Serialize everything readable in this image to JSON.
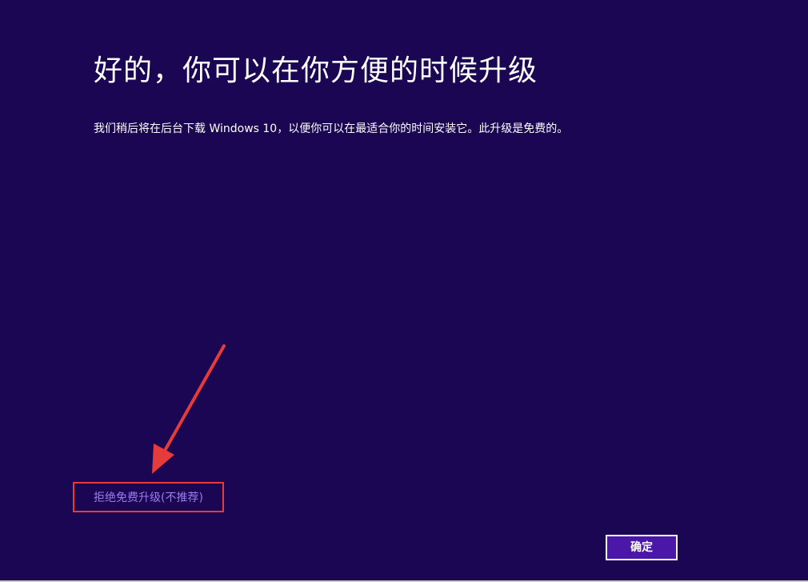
{
  "page": {
    "title": "好的，你可以在你方便的时候升级",
    "description": "我们稍后将在后台下载 Windows 10，以便你可以在最适合你的时间安装它。此升级是免费的。"
  },
  "actions": {
    "decline_label": "拒绝免费升级(不推荐)",
    "ok_label": "确定"
  },
  "colors": {
    "background": "#1a0652",
    "link": "#9b7cf0",
    "annotation": "#e53b3b",
    "button": "#4a17a8"
  }
}
